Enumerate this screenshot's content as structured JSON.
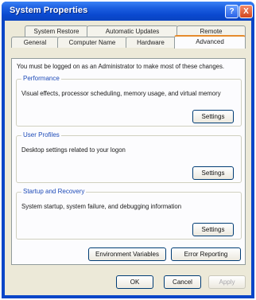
{
  "window": {
    "title": "System Properties",
    "help_glyph": "?",
    "close_glyph": "X"
  },
  "tabs": {
    "row1": [
      "System Restore",
      "Automatic Updates",
      "Remote"
    ],
    "row2": [
      "General",
      "Computer Name",
      "Hardware",
      "Advanced"
    ],
    "active": "Advanced"
  },
  "intro": "You must be logged on as an Administrator to make most of these changes.",
  "performance": {
    "title": "Performance",
    "description": "Visual effects, processor scheduling, memory usage, and virtual memory",
    "button": "Settings"
  },
  "user_profiles": {
    "title": "User Profiles",
    "description": "Desktop settings related to your logon",
    "button": "Settings"
  },
  "startup_recovery": {
    "title": "Startup and Recovery",
    "description": "System startup, system failure, and debugging information",
    "button": "Settings"
  },
  "panel_buttons": {
    "env_vars": "Environment Variables",
    "error_reporting": "Error Reporting"
  },
  "footer": {
    "ok": "OK",
    "cancel": "Cancel",
    "apply": "Apply"
  }
}
